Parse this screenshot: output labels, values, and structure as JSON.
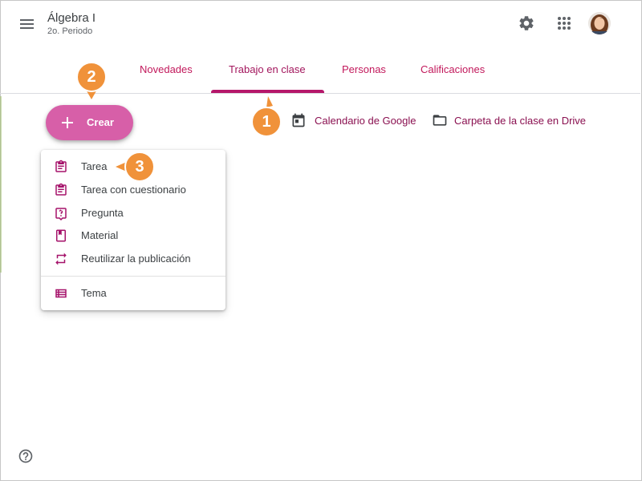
{
  "header": {
    "title": "Álgebra I",
    "subtitle": "2o. Periodo",
    "menu_icon": "hamburger-menu-icon",
    "settings_icon": "gear-icon",
    "apps_icon": "apps-grid-icon",
    "avatar_icon": "user-avatar"
  },
  "tabs": [
    {
      "label": "Novedades",
      "active": false
    },
    {
      "label": "Trabajo en clase",
      "active": true
    },
    {
      "label": "Personas",
      "active": false
    },
    {
      "label": "Calificaciones",
      "active": false
    }
  ],
  "create_button": {
    "label": "Crear",
    "icon": "plus-icon"
  },
  "links": {
    "calendar": {
      "label": "Calendario de Google",
      "icon": "calendar-icon"
    },
    "drive": {
      "label": "Carpeta de la clase en Drive",
      "icon": "folder-icon"
    }
  },
  "create_menu": {
    "items": [
      {
        "label": "Tarea",
        "icon": "assignment-icon"
      },
      {
        "label": "Tarea con cuestionario",
        "icon": "quiz-assignment-icon"
      },
      {
        "label": "Pregunta",
        "icon": "question-icon"
      },
      {
        "label": "Material",
        "icon": "material-icon"
      },
      {
        "label": "Reutilizar la publicación",
        "icon": "reuse-icon"
      },
      {
        "label": "Tema",
        "icon": "topic-icon"
      }
    ]
  },
  "callouts": [
    "1",
    "2",
    "3"
  ],
  "help_icon": "help-icon",
  "colors": {
    "accent": "#c2185b",
    "create_button": "#d75fa8",
    "callout": "#f0923a"
  }
}
